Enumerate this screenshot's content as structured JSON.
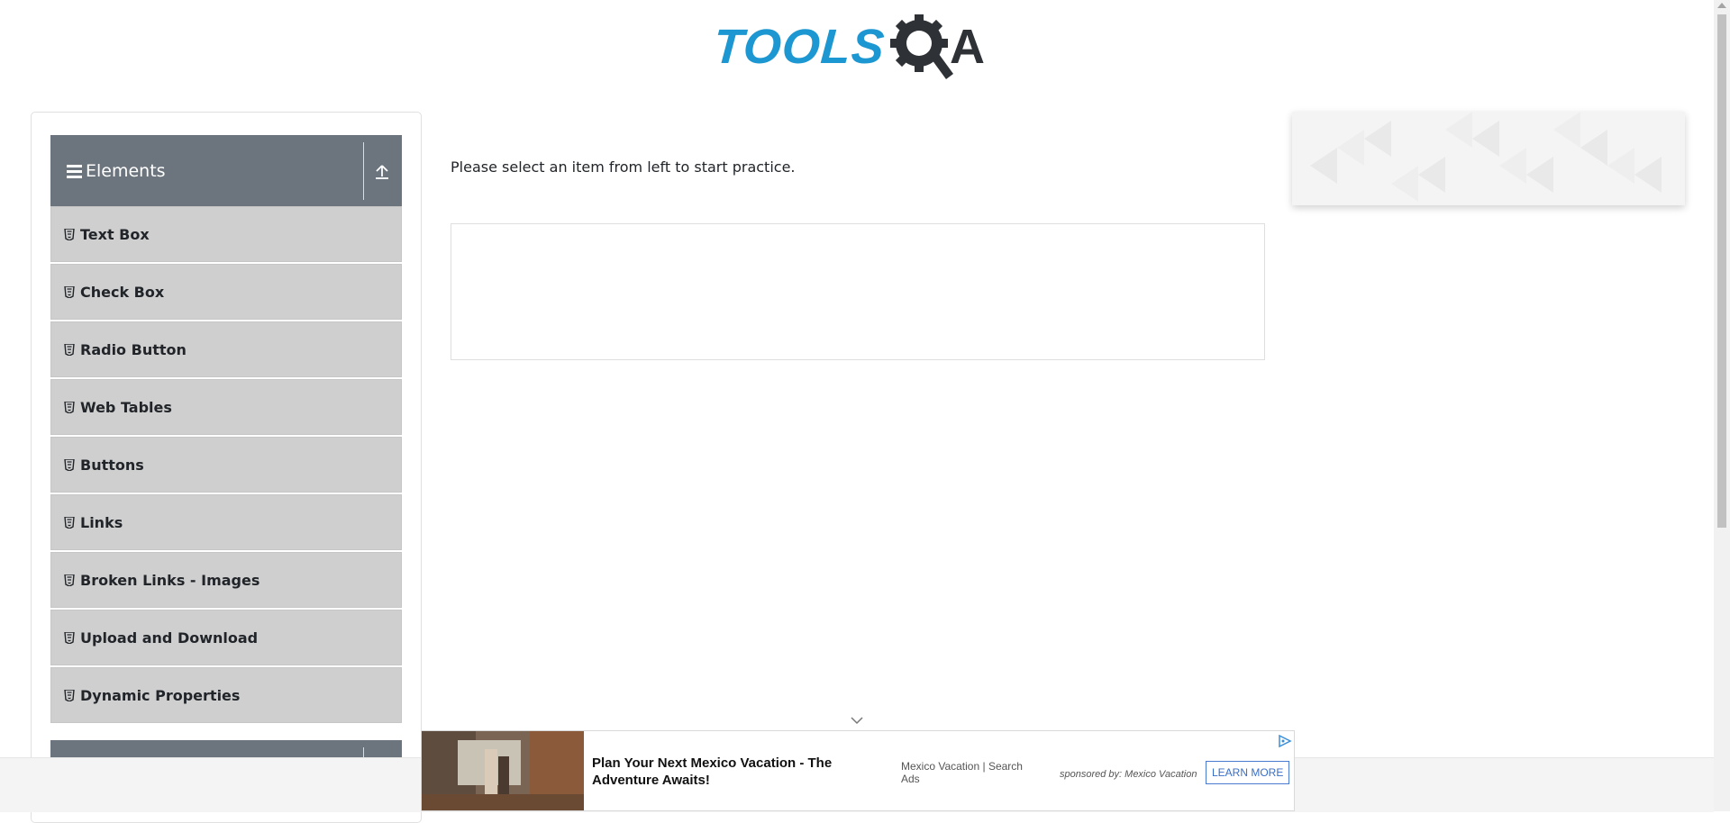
{
  "logo": {
    "part1": "TOOLS",
    "part2": "A"
  },
  "sidebar": {
    "group_title": "Elements",
    "items": [
      {
        "label": "Text Box"
      },
      {
        "label": "Check Box"
      },
      {
        "label": "Radio Button"
      },
      {
        "label": "Web Tables"
      },
      {
        "label": "Buttons"
      },
      {
        "label": "Links"
      },
      {
        "label": "Broken Links - Images"
      },
      {
        "label": "Upload and Download"
      },
      {
        "label": "Dynamic Properties"
      }
    ]
  },
  "main": {
    "instruction": "Please select an item from left to start practice."
  },
  "ad": {
    "headline": "Plan Your Next Mexico Vacation - The Adventure Awaits!",
    "source": "Mexico Vacation | Search Ads",
    "sponsor": "sponsored by: Mexico Vacation",
    "cta": "LEARN MORE"
  },
  "colors": {
    "brand_blue": "#1d97d1",
    "brand_dark": "#2e3236",
    "group_header": "#6c757d",
    "menu_item": "#cfcfcf"
  }
}
